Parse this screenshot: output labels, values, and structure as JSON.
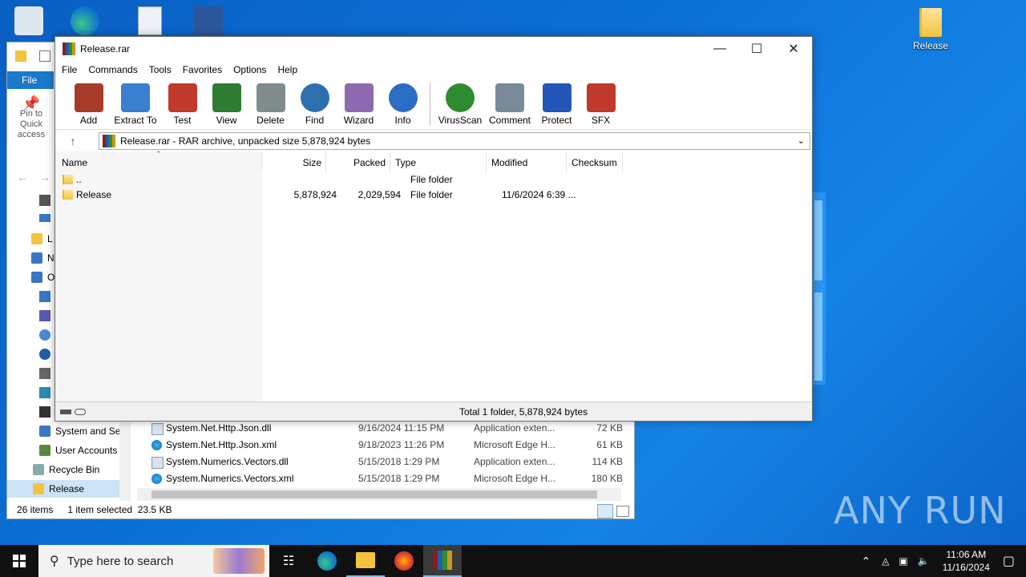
{
  "desktop": {
    "folder_label": "Release",
    "watermark": "ANY RUN"
  },
  "explorer": {
    "file_tab": "File",
    "pin_label": "Pin to Quick access",
    "nav": [
      "L",
      "N",
      "O",
      "System and Sec",
      "User Accounts",
      "Recycle Bin",
      "Release"
    ],
    "rows": [
      {
        "name": "System.Net.Http.Json.dll",
        "date": "9/16/2024 11:15 PM",
        "type": "Application exten...",
        "size": "72 KB",
        "kind": "dll"
      },
      {
        "name": "System.Net.Http.Json.xml",
        "date": "9/18/2023 11:26 PM",
        "type": "Microsoft Edge H...",
        "size": "61 KB",
        "kind": "edge"
      },
      {
        "name": "System.Numerics.Vectors.dll",
        "date": "5/15/2018 1:29 PM",
        "type": "Application exten...",
        "size": "114 KB",
        "kind": "dll"
      },
      {
        "name": "System.Numerics.Vectors.xml",
        "date": "5/15/2018 1:29 PM",
        "type": "Microsoft Edge H...",
        "size": "180 KB",
        "kind": "edge"
      }
    ],
    "status": {
      "items": "26 items",
      "selected": "1 item selected",
      "size": "23.5 KB"
    }
  },
  "rar": {
    "title": "Release.rar",
    "menu": [
      "File",
      "Commands",
      "Tools",
      "Favorites",
      "Options",
      "Help"
    ],
    "tools": [
      {
        "label": "Add",
        "color": "#a83a2a"
      },
      {
        "label": "Extract To",
        "color": "#3a7fd0"
      },
      {
        "label": "Test",
        "color": "#c0392b"
      },
      {
        "label": "View",
        "color": "#2e7d32"
      },
      {
        "label": "Delete",
        "color": "#7f8c8d"
      },
      {
        "label": "Find",
        "color": "#2f6fb0"
      },
      {
        "label": "Wizard",
        "color": "#8e6bb0"
      },
      {
        "label": "Info",
        "color": "#2b6cc4"
      },
      {
        "label": "VirusScan",
        "color": "#2e8b2e"
      },
      {
        "label": "Comment",
        "color": "#7a8a99"
      },
      {
        "label": "Protect",
        "color": "#2456b8"
      },
      {
        "label": "SFX",
        "color": "#c0392b"
      }
    ],
    "address": "Release.rar - RAR archive, unpacked size 5,878,924 bytes",
    "columns": [
      "Name",
      "Size",
      "Packed",
      "Type",
      "Modified",
      "Checksum"
    ],
    "files": [
      {
        "name": "..",
        "size": "",
        "packed": "",
        "type": "File folder",
        "modified": ""
      },
      {
        "name": "Release",
        "size": "5,878,924",
        "packed": "2,029,594",
        "type": "File folder",
        "modified": "11/6/2024 6:39 ..."
      }
    ],
    "status": "Total 1 folder, 5,878,924 bytes"
  },
  "taskbar": {
    "search_placeholder": "Type here to search",
    "time": "11:06 AM",
    "date": "11/16/2024"
  }
}
